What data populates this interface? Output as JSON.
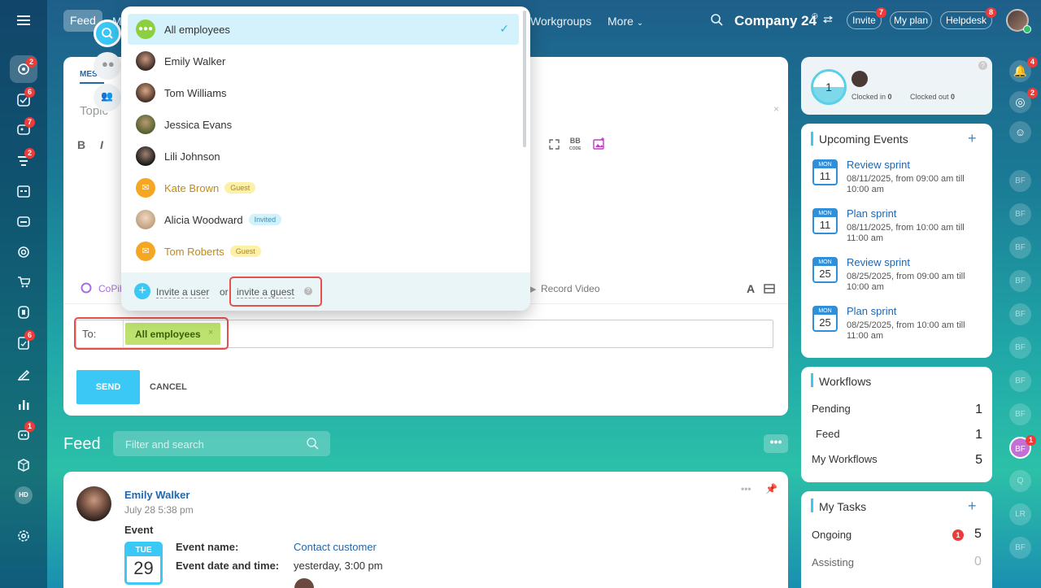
{
  "topbar": {
    "feed_tab": "Feed",
    "tab_m": "M",
    "workgroups": "Workgroups",
    "more": "More",
    "company": "Company 24",
    "invite": "Invite",
    "invite_badge": "7",
    "my_plan": "My plan",
    "helpdesk": "Helpdesk",
    "helpdesk_badge": "8"
  },
  "sidebar": {
    "badges": {
      "feed": "2",
      "tasks": "6",
      "chat": "7",
      "pipelines": "2",
      "docs": "6",
      "bot": "1"
    },
    "hd_label": "HD"
  },
  "composer": {
    "tab_label": "MES",
    "topic_placeholder": "Topic",
    "copilot": "CoPil",
    "record_video": "Record Video",
    "to_label": "To:",
    "recipient": "All employees",
    "send": "SEND",
    "cancel": "CANCEL"
  },
  "dropdown": {
    "items": [
      {
        "name": "All employees",
        "tag": ""
      },
      {
        "name": "Emily Walker",
        "tag": ""
      },
      {
        "name": "Tom Williams",
        "tag": ""
      },
      {
        "name": "Jessica Evans",
        "tag": ""
      },
      {
        "name": "Lili Johnson",
        "tag": ""
      },
      {
        "name": "Kate Brown",
        "tag": "Guest"
      },
      {
        "name": "Alicia Woodward",
        "tag": "Invited"
      },
      {
        "name": "Tom Roberts",
        "tag": "Guest"
      }
    ],
    "invite_user": "Invite a user",
    "or": "or",
    "invite_guest": "invite a guest"
  },
  "feed": {
    "title": "Feed",
    "search_placeholder": "Filter and search",
    "post": {
      "author": "Emily Walker",
      "date": "July 28 5:38 pm",
      "type": "Event",
      "event_name_label": "Event name:",
      "event_name": "Contact customer",
      "event_date_label": "Event date and time:",
      "event_date": "yesterday, 3:00 pm",
      "day_month": "TUE",
      "day_num": "29"
    }
  },
  "timeman": {
    "counter": "1",
    "clocked_in": "Clocked in",
    "clocked_in_count": "0",
    "clocked_out": "Clocked out",
    "clocked_out_count": "0"
  },
  "events": {
    "title": "Upcoming Events",
    "items": [
      {
        "month": "MON",
        "day": "11",
        "title": "Review sprint",
        "time": "08/11/2025, from 09:00 am till 10:00 am"
      },
      {
        "month": "MON",
        "day": "11",
        "title": "Plan sprint",
        "time": "08/11/2025, from 10:00 am till 11:00 am"
      },
      {
        "month": "MON",
        "day": "25",
        "title": "Review sprint",
        "time": "08/25/2025, from 09:00 am till 10:00 am"
      },
      {
        "month": "MON",
        "day": "25",
        "title": "Plan sprint",
        "time": "08/25/2025, from 10:00 am till 11:00 am"
      }
    ]
  },
  "workflows": {
    "title": "Workflows",
    "rows": [
      {
        "label": "Pending",
        "count": "1"
      },
      {
        "label": "Feed",
        "count": "1"
      },
      {
        "label": "My Workflows",
        "count": "5"
      }
    ]
  },
  "tasks": {
    "title": "My Tasks",
    "rows": [
      {
        "label": "Ongoing",
        "count": "5",
        "badge": "1"
      },
      {
        "label": "Assisting",
        "count": "0"
      }
    ]
  },
  "rightbar": {
    "initials": [
      "BF",
      "BF",
      "BF",
      "BF",
      "BF",
      "BF",
      "BF",
      "BF",
      "BF",
      "Q",
      "LR",
      "BF"
    ],
    "bell_badge": "4",
    "target_badge": "2",
    "bf_badge": "1"
  }
}
